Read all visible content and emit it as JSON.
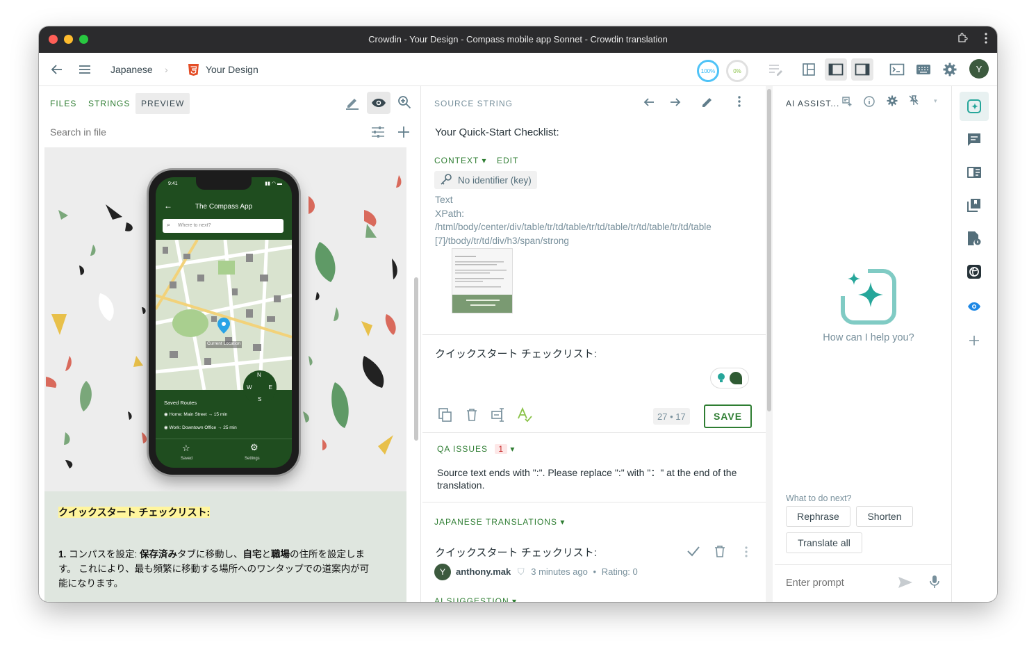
{
  "window": {
    "title": "Crowdin - Your Design - Compass mobile app Sonnet - Crowdin translation"
  },
  "toolbar": {
    "language": "Japanese",
    "file": "Your Design",
    "progress_translated": "100%",
    "progress_approved": "0%",
    "user_initial": "Y"
  },
  "left": {
    "tabs": [
      "FILES",
      "STRINGS",
      "PREVIEW"
    ],
    "active_tab": "PREVIEW",
    "search_placeholder": "Search in file",
    "phone": {
      "time": "9:41",
      "app_title": "The Compass App",
      "search_placeholder": "Where to next?",
      "map_label": "Current Location",
      "compass": {
        "n": "N",
        "s": "S",
        "e": "E",
        "w": "W"
      },
      "saved_routes_title": "Saved Routes",
      "routes": [
        "Home: Main Street → 15 min",
        "Work: Downtown Office → 25 min"
      ],
      "nav": [
        "Saved",
        "Settings"
      ]
    },
    "heading": "クイックスタート チェックリスト:",
    "para_num": "1.",
    "para_a": " コンパスを設定: ",
    "para_b": "保存済み",
    "para_c": "タブに移動し、",
    "para_d": "自宅",
    "para_e": "と",
    "para_f": "職場",
    "para_g": "の住所を設定しま",
    "para_line2": "す。 これにより、最も頻繁に移動する場所へのワンタップでの道案内が可",
    "para_line3": "能になります。"
  },
  "source": {
    "header": "SOURCE STRING",
    "text": "Your Quick-Start Checklist:",
    "context_label": "CONTEXT",
    "edit_label": "EDIT",
    "identifier": "No identifier (key)",
    "type": "Text",
    "xpath_label": "XPath:",
    "xpath_line1": "/html/body/center/div/table/tr/td/table/tr/td/table/tr/td/table/tr/td/table",
    "xpath_line2": "[7]/tbody/tr/td/div/h3/span/strong"
  },
  "editor": {
    "translation": "クイックスタート チェックリスト:",
    "counts": "27 • 17",
    "save_label": "SAVE"
  },
  "qa": {
    "label": "QA ISSUES",
    "count": "1",
    "message_line1": "Source text ends with \":\". Please replace \":\" with \"：\" at the end of the",
    "message_line2": "translation."
  },
  "translations": {
    "label": "JAPANESE TRANSLATIONS",
    "items": [
      {
        "text": "クイックスタート チェックリスト:",
        "author": "anthony.mak",
        "avatar": "Y",
        "time": "3 minutes ago",
        "rating": "Rating: 0"
      }
    ],
    "ai_suggestion_label": "AI SUGGESTION"
  },
  "ai": {
    "title": "AI ASSIST...",
    "empty_text": "How can I help you?",
    "next_label": "What to do next?",
    "actions": [
      "Rephrase",
      "Shorten",
      "Translate all"
    ],
    "prompt_placeholder": "Enter prompt"
  },
  "colors": {
    "accent": "#2e7d32",
    "teal": "#26a69a",
    "rail_blue": "#1e88e5",
    "phone_green": "#1f4d1f"
  }
}
